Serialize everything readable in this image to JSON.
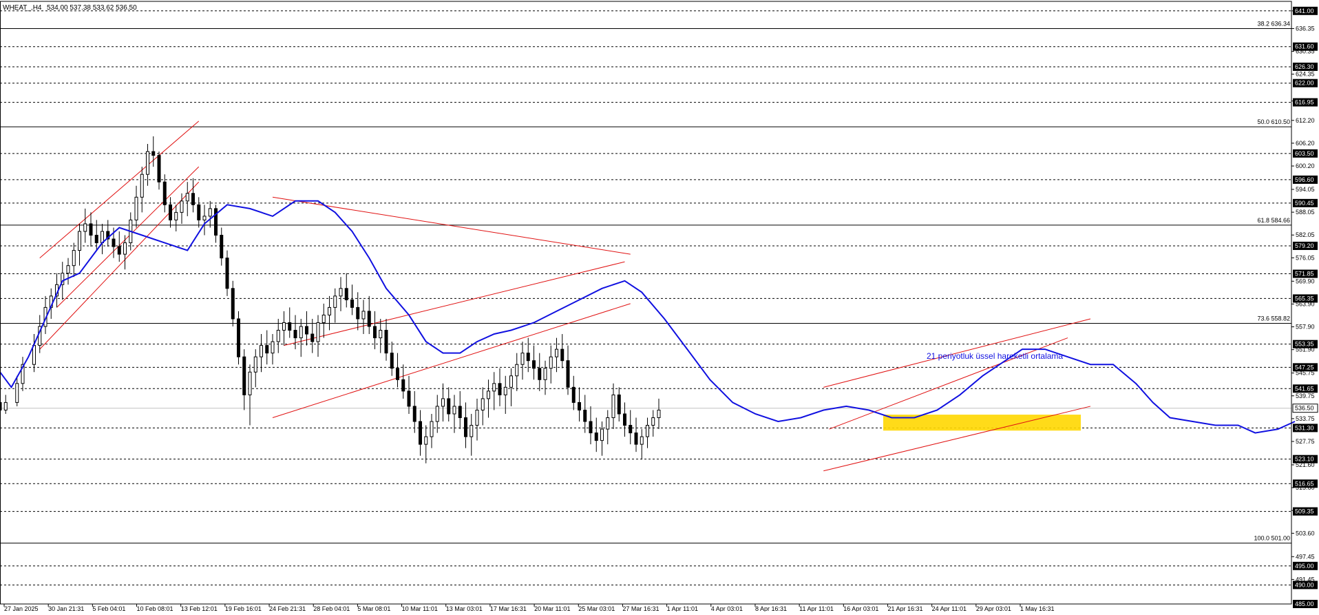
{
  "header": {
    "symbol": "WHEAT_,H4",
    "ohlc": "534.00 537.38 533.62 536.50"
  },
  "chart_data": {
    "type": "candlestick",
    "title": "WHEAT_,H4",
    "ylim": [
      485.0,
      643.5
    ],
    "grid": false,
    "y_ticks": [
      "641.00",
      "636.35",
      "630.35",
      "624.35",
      "617.30",
      "612.20",
      "606.20",
      "600.20",
      "594.05",
      "588.05",
      "582.05",
      "576.05",
      "569.90",
      "563.90",
      "557.90",
      "551.90",
      "545.75",
      "539.75",
      "533.75",
      "527.75",
      "521.60",
      "515.60",
      "509.60",
      "503.60",
      "497.45",
      "491.45"
    ],
    "x_ticks": [
      "27 Jan 2025",
      "30 Jan 21:31",
      "5 Feb 04:01",
      "10 Feb 08:01",
      "13 Feb 12:01",
      "19 Feb 16:01",
      "24 Feb 21:31",
      "28 Feb 04:01",
      "5 Mar 08:01",
      "10 Mar 11:01",
      "13 Mar 03:01",
      "17 Mar 16:31",
      "20 Mar 11:01",
      "25 Mar 03:01",
      "27 Mar 16:31",
      "1 Apr 11:01",
      "4 Apr 03:01",
      "8 Apr 16:31",
      "11 Apr 11:01",
      "16 Apr 03:01",
      "21 Apr 16:31",
      "24 Apr 11:01",
      "29 Apr 03:01",
      "1 May 16:31"
    ],
    "dashed_levels": [
      "641.00",
      "631.60",
      "626.30",
      "622.00",
      "616.95",
      "603.50",
      "596.60",
      "590.45",
      "579.20",
      "571.85",
      "565.35",
      "553.35",
      "547.25",
      "541.65",
      "531.30",
      "523.10",
      "516.65",
      "509.35",
      "495.00",
      "490.00",
      "485.00"
    ],
    "price_label": "536.50",
    "fibonacci": [
      {
        "label": "38.2 636.34"
      },
      {
        "label": "50.0 610.50"
      },
      {
        "label": "61.8 584.66"
      },
      {
        "label": "73.6 558.82"
      },
      {
        "label": "100.0 501.00"
      }
    ],
    "ema": {
      "name": "21 periyotluk üssel hareketli ortalama",
      "color": "#1010e0",
      "points": [
        [
          0,
          546
        ],
        [
          0.02,
          542
        ],
        [
          0.05,
          550
        ],
        [
          0.08,
          560
        ],
        [
          0.11,
          570
        ],
        [
          0.14,
          572
        ],
        [
          0.18,
          580
        ],
        [
          0.21,
          584
        ],
        [
          0.25,
          582
        ],
        [
          0.29,
          580
        ],
        [
          0.33,
          578
        ],
        [
          0.36,
          585
        ],
        [
          0.4,
          590
        ],
        [
          0.44,
          589
        ],
        [
          0.48,
          587
        ],
        [
          0.52,
          591
        ],
        [
          0.56,
          591
        ],
        [
          0.59,
          588
        ],
        [
          0.62,
          583
        ],
        [
          0.65,
          576
        ],
        [
          0.68,
          568
        ],
        [
          0.72,
          561
        ],
        [
          0.75,
          554
        ],
        [
          0.78,
          551
        ],
        [
          0.81,
          551
        ],
        [
          0.84,
          554
        ],
        [
          0.87,
          556
        ],
        [
          0.9,
          557
        ],
        [
          0.94,
          559
        ],
        [
          0.98,
          562
        ],
        [
          1.02,
          565
        ],
        [
          1.06,
          568
        ],
        [
          1.1,
          570
        ],
        [
          1.13,
          567
        ],
        [
          1.17,
          560
        ],
        [
          1.21,
          552
        ],
        [
          1.25,
          544
        ],
        [
          1.29,
          538
        ],
        [
          1.33,
          535
        ],
        [
          1.37,
          533
        ],
        [
          1.41,
          534
        ],
        [
          1.45,
          536
        ],
        [
          1.49,
          537
        ],
        [
          1.53,
          536
        ],
        [
          1.57,
          534
        ],
        [
          1.61,
          534
        ],
        [
          1.65,
          536
        ],
        [
          1.69,
          540
        ],
        [
          1.73,
          545
        ],
        [
          1.77,
          549
        ],
        [
          1.8,
          552
        ],
        [
          1.84,
          552
        ],
        [
          1.88,
          550
        ],
        [
          1.92,
          548
        ],
        [
          1.96,
          548
        ],
        [
          2.0,
          543
        ],
        [
          2.03,
          538
        ],
        [
          2.06,
          534
        ],
        [
          2.1,
          533
        ],
        [
          2.14,
          532
        ],
        [
          2.18,
          532
        ],
        [
          2.21,
          530
        ],
        [
          2.25,
          531
        ],
        [
          2.28,
          533
        ]
      ]
    },
    "channels": [
      {
        "name": "channel-1",
        "lines": [
          [
            [
              0.07,
              576
            ],
            [
              0.35,
              612
            ]
          ],
          [
            [
              0.07,
              552
            ],
            [
              0.35,
              596
            ]
          ],
          [
            [
              0.1,
              563
            ],
            [
              0.35,
              600
            ]
          ]
        ]
      },
      {
        "name": "channel-2",
        "lines": [
          [
            [
              0.48,
              592
            ],
            [
              1.11,
              577
            ]
          ],
          [
            [
              0.48,
              534
            ],
            [
              1.11,
              564
            ]
          ],
          [
            [
              0.5,
              553
            ],
            [
              1.1,
              575
            ]
          ]
        ]
      },
      {
        "name": "channel-3",
        "lines": [
          [
            [
              1.45,
              520
            ],
            [
              1.92,
              537
            ]
          ],
          [
            [
              1.45,
              542
            ],
            [
              1.92,
              560
            ]
          ],
          [
            [
              1.46,
              531
            ],
            [
              1.88,
              555
            ]
          ]
        ]
      }
    ],
    "zone": {
      "from": 530.6,
      "to": 534.8,
      "color": "#ffd700"
    },
    "ohlc_candles": [
      [
        0,
        538,
        537.5,
        534,
        536
      ],
      [
        0.01,
        536,
        540,
        535,
        538
      ],
      [
        0.03,
        538,
        545,
        537,
        543
      ],
      [
        0.04,
        543,
        550,
        541,
        548
      ],
      [
        0.06,
        548,
        556,
        546,
        553
      ],
      [
        0.07,
        553,
        561,
        551,
        558
      ],
      [
        0.08,
        558,
        566,
        556,
        563
      ],
      [
        0.09,
        563,
        568,
        560,
        566
      ],
      [
        0.1,
        566,
        572,
        563,
        569
      ],
      [
        0.11,
        569,
        575,
        565,
        572
      ],
      [
        0.12,
        572,
        576,
        569,
        574
      ],
      [
        0.13,
        574,
        580,
        571,
        578
      ],
      [
        0.14,
        578,
        585,
        574,
        583
      ],
      [
        0.15,
        583,
        589,
        580,
        585
      ],
      [
        0.16,
        585,
        588,
        579,
        582
      ],
      [
        0.17,
        582,
        586,
        578,
        580
      ],
      [
        0.18,
        580,
        585,
        577,
        583
      ],
      [
        0.19,
        583,
        586,
        579,
        581
      ],
      [
        0.2,
        581,
        584,
        576,
        579
      ],
      [
        0.21,
        579,
        583,
        575,
        577
      ],
      [
        0.22,
        577,
        582,
        573,
        580
      ],
      [
        0.23,
        580,
        588,
        578,
        586
      ],
      [
        0.24,
        586,
        595,
        584,
        592
      ],
      [
        0.25,
        592,
        600,
        588,
        598
      ],
      [
        0.26,
        598,
        606,
        595,
        604
      ],
      [
        0.27,
        604,
        608,
        600,
        603
      ],
      [
        0.28,
        603,
        604,
        594,
        596
      ],
      [
        0.29,
        596,
        598,
        588,
        590
      ],
      [
        0.3,
        590,
        592,
        584,
        586
      ],
      [
        0.31,
        586,
        590,
        583,
        588
      ],
      [
        0.32,
        588,
        593,
        585,
        591
      ],
      [
        0.33,
        591,
        596,
        587,
        593
      ],
      [
        0.34,
        593,
        597,
        588,
        590
      ],
      [
        0.35,
        590,
        592,
        584,
        586
      ],
      [
        0.36,
        586,
        590,
        582,
        587
      ],
      [
        0.37,
        587,
        591,
        584,
        589
      ],
      [
        0.38,
        589,
        590,
        580,
        582
      ],
      [
        0.39,
        582,
        584,
        574,
        576
      ],
      [
        0.4,
        576,
        578,
        566,
        568
      ],
      [
        0.41,
        568,
        570,
        558,
        560
      ],
      [
        0.42,
        560,
        562,
        548,
        550
      ],
      [
        0.43,
        550,
        552,
        536,
        540
      ],
      [
        0.44,
        540,
        548,
        532,
        546
      ],
      [
        0.45,
        546,
        552,
        542,
        550
      ],
      [
        0.46,
        550,
        556,
        546,
        553
      ],
      [
        0.47,
        553,
        557,
        548,
        551
      ],
      [
        0.48,
        551,
        556,
        548,
        554
      ],
      [
        0.49,
        554,
        560,
        551,
        557
      ],
      [
        0.5,
        557,
        562,
        553,
        559
      ],
      [
        0.51,
        559,
        563,
        555,
        557
      ],
      [
        0.52,
        557,
        561,
        552,
        555
      ],
      [
        0.53,
        555,
        560,
        550,
        558
      ],
      [
        0.54,
        558,
        562,
        553,
        556
      ],
      [
        0.55,
        556,
        560,
        551,
        554
      ],
      [
        0.56,
        554,
        561,
        550,
        559
      ],
      [
        0.57,
        559,
        564,
        555,
        561
      ],
      [
        0.58,
        561,
        566,
        557,
        563
      ],
      [
        0.59,
        563,
        568,
        559,
        566
      ],
      [
        0.6,
        566,
        571,
        562,
        568
      ],
      [
        0.61,
        568,
        572,
        563,
        565
      ],
      [
        0.62,
        565,
        569,
        561,
        563
      ],
      [
        0.63,
        563,
        567,
        557,
        560
      ],
      [
        0.64,
        560,
        565,
        556,
        562
      ],
      [
        0.65,
        562,
        566,
        556,
        558
      ],
      [
        0.66,
        558,
        562,
        552,
        555
      ],
      [
        0.67,
        555,
        560,
        551,
        557
      ],
      [
        0.68,
        557,
        560,
        549,
        551
      ],
      [
        0.69,
        551,
        554,
        545,
        547
      ],
      [
        0.7,
        547,
        551,
        542,
        544
      ],
      [
        0.71,
        544,
        548,
        539,
        541
      ],
      [
        0.72,
        541,
        545,
        535,
        537
      ],
      [
        0.73,
        537,
        541,
        530,
        533
      ],
      [
        0.74,
        533,
        536,
        524,
        527
      ],
      [
        0.75,
        527,
        532,
        522,
        529
      ],
      [
        0.76,
        529,
        535,
        526,
        533
      ],
      [
        0.77,
        533,
        540,
        530,
        537
      ],
      [
        0.78,
        537,
        543,
        533,
        539
      ],
      [
        0.79,
        539,
        542,
        533,
        535
      ],
      [
        0.8,
        535,
        540,
        530,
        537
      ],
      [
        0.81,
        537,
        541,
        531,
        534
      ],
      [
        0.82,
        534,
        538,
        526,
        529
      ],
      [
        0.83,
        529,
        535,
        524,
        532
      ],
      [
        0.84,
        532,
        539,
        528,
        536
      ],
      [
        0.85,
        536,
        542,
        532,
        539
      ],
      [
        0.86,
        539,
        544,
        534,
        541
      ],
      [
        0.87,
        541,
        546,
        536,
        543
      ],
      [
        0.88,
        543,
        547,
        537,
        540
      ],
      [
        0.89,
        540,
        545,
        535,
        542
      ],
      [
        0.9,
        542,
        547,
        537,
        545
      ],
      [
        0.91,
        545,
        551,
        541,
        548
      ],
      [
        0.92,
        548,
        554,
        544,
        551
      ],
      [
        0.93,
        551,
        555,
        546,
        549
      ],
      [
        0.94,
        549,
        553,
        544,
        547
      ],
      [
        0.95,
        547,
        551,
        541,
        544
      ],
      [
        0.96,
        544,
        549,
        540,
        547
      ],
      [
        0.97,
        547,
        553,
        543,
        550
      ],
      [
        0.98,
        550,
        555,
        546,
        552
      ],
      [
        0.99,
        552,
        556,
        547,
        549
      ],
      [
        1.0,
        549,
        553,
        540,
        542
      ],
      [
        1.01,
        542,
        545,
        536,
        538
      ],
      [
        1.02,
        538,
        542,
        533,
        536
      ],
      [
        1.03,
        536,
        540,
        530,
        533
      ],
      [
        1.04,
        533,
        537,
        527,
        530
      ],
      [
        1.05,
        530,
        534,
        525,
        528
      ],
      [
        1.06,
        528,
        533,
        524,
        531
      ],
      [
        1.07,
        531,
        536,
        527,
        534
      ],
      [
        1.08,
        534,
        543,
        531,
        540
      ],
      [
        1.09,
        540,
        542,
        533,
        535
      ],
      [
        1.1,
        535,
        538,
        529,
        532
      ],
      [
        1.11,
        532,
        536,
        527,
        530
      ],
      [
        1.12,
        530,
        534,
        525,
        527
      ],
      [
        1.13,
        527,
        531,
        523,
        529
      ],
      [
        1.14,
        529,
        534,
        526,
        532
      ],
      [
        1.15,
        532,
        536,
        529,
        534
      ],
      [
        1.16,
        534,
        539,
        531,
        536
      ]
    ]
  }
}
